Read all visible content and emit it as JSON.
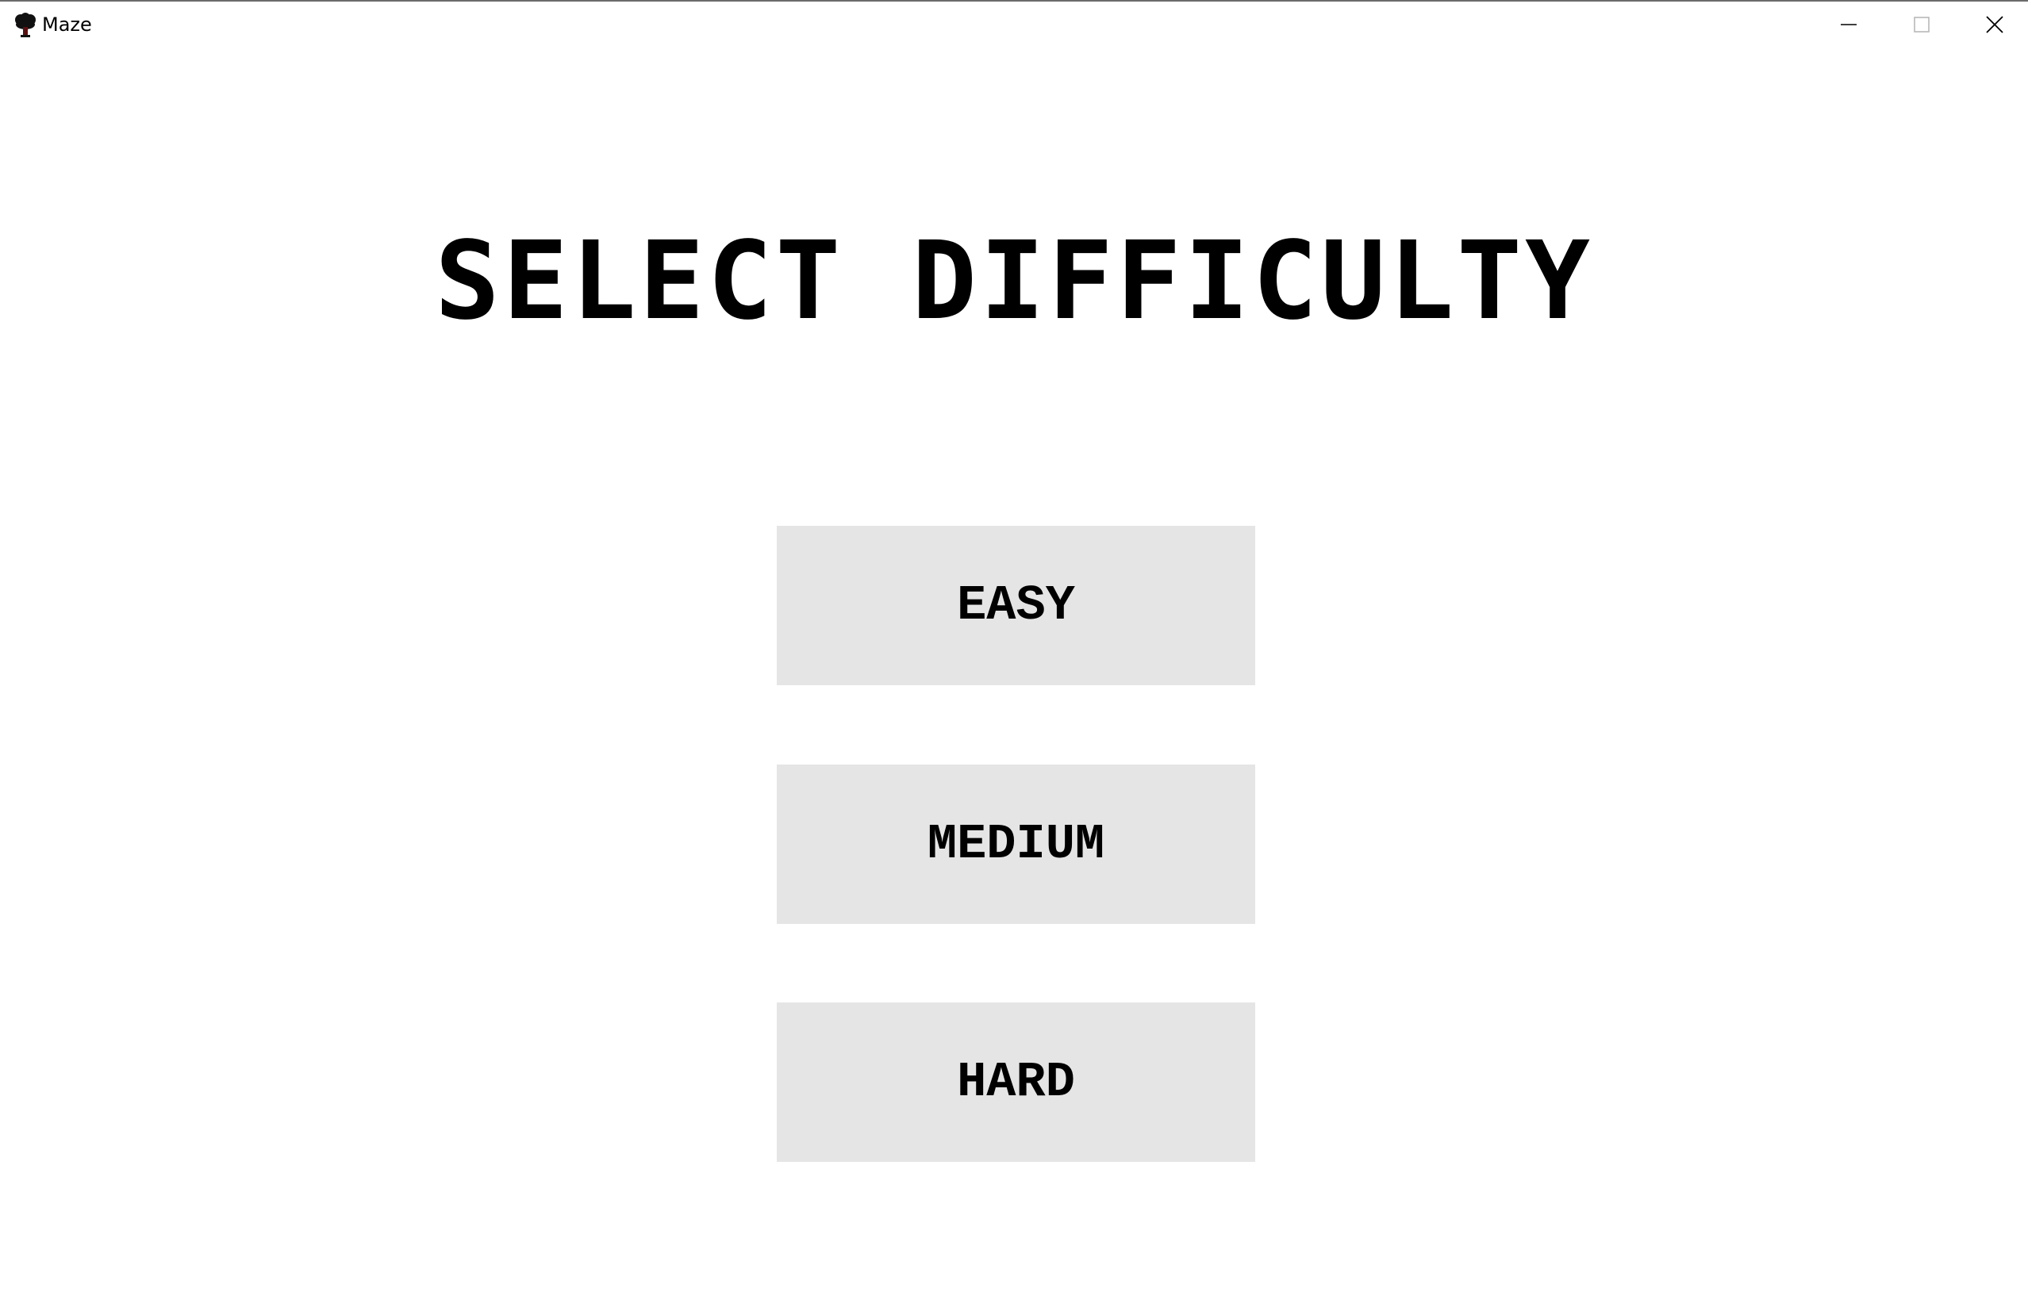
{
  "window": {
    "title": "Maze",
    "app_icon": "tree-icon",
    "controls": {
      "minimize_icon": "minimize-icon",
      "maximize_icon": "maximize-icon",
      "close_icon": "close-icon"
    }
  },
  "main": {
    "heading": "SELECT DIFFICULTY",
    "buttons": [
      {
        "label": "EASY"
      },
      {
        "label": "MEDIUM"
      },
      {
        "label": "HARD"
      }
    ]
  },
  "colors": {
    "background": "#ffffff",
    "button_bg": "#e5e5e5",
    "text": "#000000"
  }
}
